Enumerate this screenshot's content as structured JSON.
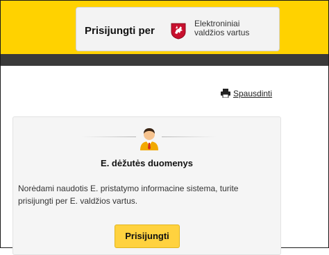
{
  "header": {
    "login_label": "Prisijungti per",
    "provider_line1": "Elektroniniai",
    "provider_line2": "valdžios vartus",
    "crest_icon": "lithuanian-coat-of-arms-icon",
    "bar_color": "#ffd200"
  },
  "toolbar": {
    "print_label": "Spausdinti",
    "print_icon": "printer-icon"
  },
  "panel": {
    "avatar_icon": "user-icon",
    "title": "E. dėžutės duomenys",
    "description": "Norėdami naudotis E. pristatymo informacine sistema, turite prisijungti per E. valdžios vartus.",
    "login_button": "Prisijungti",
    "button_color": "#ffd23f"
  }
}
